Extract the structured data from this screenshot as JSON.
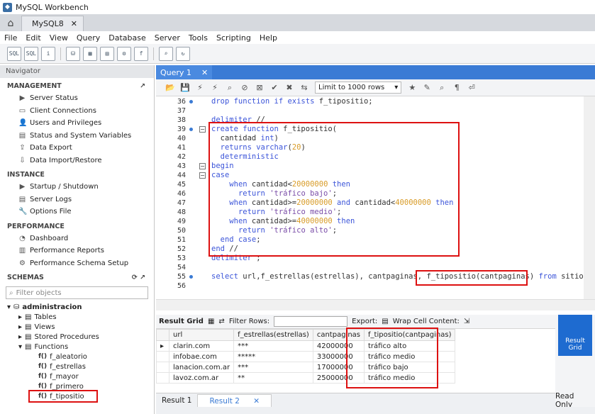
{
  "window": {
    "title": "MySQL Workbench",
    "connection_tab": "MySQL8"
  },
  "menu": [
    "File",
    "Edit",
    "View",
    "Query",
    "Database",
    "Server",
    "Tools",
    "Scripting",
    "Help"
  ],
  "navigator": {
    "header": "Navigator",
    "management": {
      "title": "MANAGEMENT",
      "items": [
        "Server Status",
        "Client Connections",
        "Users and Privileges",
        "Status and System Variables",
        "Data Export",
        "Data Import/Restore"
      ]
    },
    "instance": {
      "title": "INSTANCE",
      "items": [
        "Startup / Shutdown",
        "Server Logs",
        "Options File"
      ]
    },
    "performance": {
      "title": "PERFORMANCE",
      "items": [
        "Dashboard",
        "Performance Reports",
        "Performance Schema Setup"
      ]
    },
    "schemas": {
      "title": "SCHEMAS",
      "filter_placeholder": "Filter objects",
      "db": "administracion",
      "nodes": [
        "Tables",
        "Views",
        "Stored Procedures",
        "Functions"
      ],
      "functions": [
        "f_aleatorio",
        "f_estrellas",
        "f_mayor",
        "f_primero",
        "f_tipositio"
      ],
      "fn_icon_label": "f()"
    }
  },
  "editor": {
    "tab_label": "Query 1",
    "limit_label": "Limit to 1000 rows",
    "lines": [
      {
        "n": "36",
        "dot": true,
        "fold": "",
        "html": "<span class='kw'>drop function if exists</span> f_tipositio;"
      },
      {
        "n": "37",
        "dot": false,
        "fold": "",
        "html": ""
      },
      {
        "n": "38",
        "dot": false,
        "fold": "",
        "html": "<span class='kw'>delimiter</span> //"
      },
      {
        "n": "39",
        "dot": true,
        "fold": "−",
        "html": "<span class='kw'>create function</span> f_tipositio("
      },
      {
        "n": "40",
        "dot": false,
        "fold": "",
        "html": "  cantidad <span class='kw'>int</span>)"
      },
      {
        "n": "41",
        "dot": false,
        "fold": "",
        "html": "  <span class='kw'>returns varchar</span>(<span class='num'>20</span>)"
      },
      {
        "n": "42",
        "dot": false,
        "fold": "",
        "html": "  <span class='kw'>deterministic</span>"
      },
      {
        "n": "43",
        "dot": false,
        "fold": "−",
        "html": "<span class='kw'>begin</span>"
      },
      {
        "n": "44",
        "dot": false,
        "fold": "−",
        "html": "<span class='kw'>case</span>"
      },
      {
        "n": "45",
        "dot": false,
        "fold": "",
        "html": "    <span class='kw'>when</span> cantidad&lt;<span class='num'>20000000</span> <span class='kw'>then</span>"
      },
      {
        "n": "46",
        "dot": false,
        "fold": "",
        "html": "      <span class='kw'>return</span> <span class='str'>'tráfico bajo'</span>;"
      },
      {
        "n": "47",
        "dot": false,
        "fold": "",
        "html": "    <span class='kw'>when</span> cantidad&gt;=<span class='num'>20000000</span> <span class='kw'>and</span> cantidad&lt;<span class='num'>40000000</span> <span class='kw'>then</span>"
      },
      {
        "n": "48",
        "dot": false,
        "fold": "",
        "html": "      <span class='kw'>return</span> <span class='str'>'tráfico medio'</span>;"
      },
      {
        "n": "49",
        "dot": false,
        "fold": "",
        "html": "    <span class='kw'>when</span> cantidad&gt;=<span class='num'>40000000</span> <span class='kw'>then</span>"
      },
      {
        "n": "50",
        "dot": false,
        "fold": "",
        "html": "      <span class='kw'>return</span> <span class='str'>'tráfico alto'</span>;"
      },
      {
        "n": "51",
        "dot": false,
        "fold": "",
        "html": "  <span class='kw'>end case</span>;"
      },
      {
        "n": "52",
        "dot": false,
        "fold": "",
        "html": "<span class='kw'>end</span> //"
      },
      {
        "n": "53",
        "dot": false,
        "fold": "",
        "html": "<span class='kw'>delimiter</span> ;"
      },
      {
        "n": "54",
        "dot": false,
        "fold": "",
        "html": ""
      },
      {
        "n": "55",
        "dot": true,
        "fold": "",
        "html": "<span class='kw'>select</span> url,f_estrellas(estrellas), cantpaginas, f_tipositio(cantpaginas) <span class='kw'>from</span> sitios;"
      },
      {
        "n": "56",
        "dot": false,
        "fold": "",
        "html": ""
      }
    ]
  },
  "results": {
    "toolbar": {
      "result_grid": "Result Grid",
      "filter_rows": "Filter Rows:",
      "export": "Export:",
      "wrap": "Wrap Cell Content:"
    },
    "columns": [
      "url",
      "f_estrellas(estrellas)",
      "cantpaginas",
      "f_tipositio(cantpaginas)"
    ],
    "rows": [
      [
        "clarin.com",
        "***",
        "42000000",
        "tráfico alto"
      ],
      [
        "infobae.com",
        "*****",
        "33000000",
        "tráfico medio"
      ],
      [
        "lanacion.com.ar",
        "***",
        "17000000",
        "tráfico bajo"
      ],
      [
        "lavoz.com.ar",
        "**",
        "25000000",
        "tráfico medio"
      ]
    ],
    "tabs": [
      "Result 1",
      "Result 2"
    ],
    "side_button": "Result Grid",
    "read_only": "Read Only"
  }
}
